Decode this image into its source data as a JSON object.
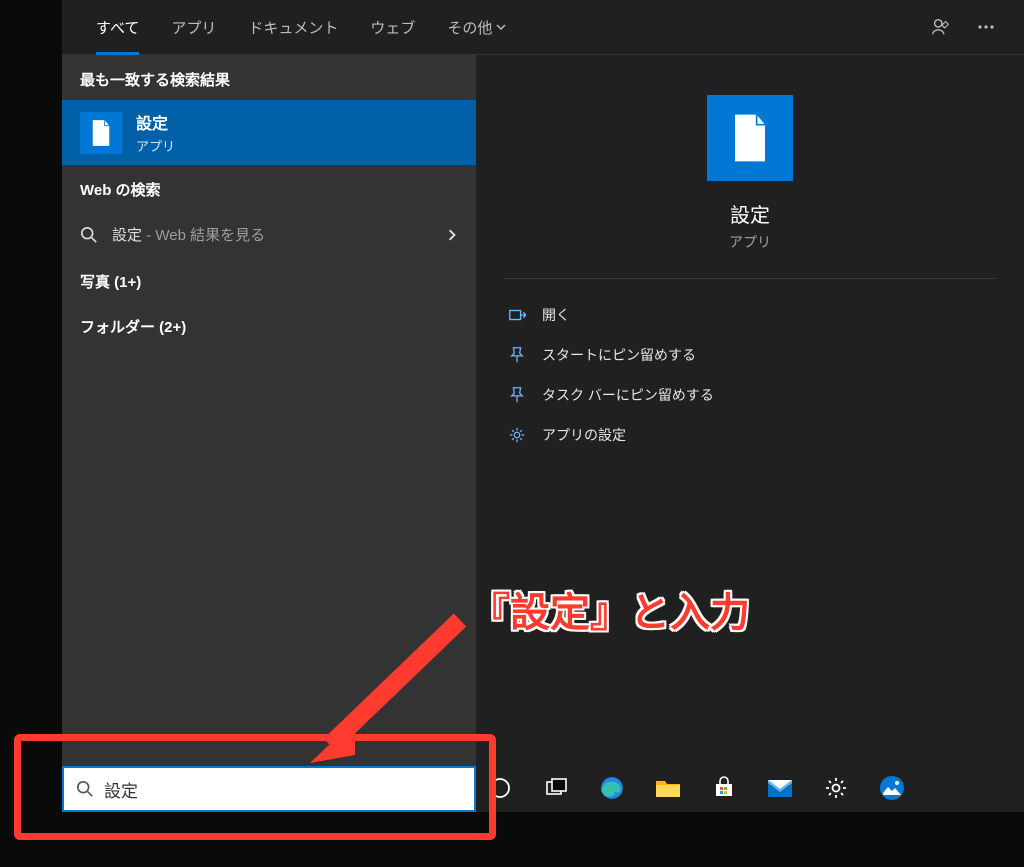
{
  "tabs": {
    "items": [
      {
        "label": "すべて",
        "active": true
      },
      {
        "label": "アプリ",
        "active": false
      },
      {
        "label": "ドキュメント",
        "active": false
      },
      {
        "label": "ウェブ",
        "active": false
      },
      {
        "label": "その他",
        "active": false,
        "dropdown": true
      }
    ]
  },
  "left": {
    "bestMatchHeader": "最も一致する検索結果",
    "bestMatch": {
      "title": "設定",
      "subtitle": "アプリ"
    },
    "webHeader": "Web の検索",
    "webSearch": {
      "query": "設定",
      "suffix": " - Web 結果を見る"
    },
    "categories": [
      {
        "label": "写真 (1+)"
      },
      {
        "label": "フォルダー (2+)"
      }
    ]
  },
  "preview": {
    "title": "設定",
    "subtitle": "アプリ",
    "actions": [
      {
        "label": "開く",
        "icon": "open"
      },
      {
        "label": "スタートにピン留めする",
        "icon": "pin"
      },
      {
        "label": "タスク バーにピン留めする",
        "icon": "pin"
      },
      {
        "label": "アプリの設定",
        "icon": "gear"
      }
    ]
  },
  "search": {
    "value": "設定"
  },
  "annotation": {
    "text": "『設定』と入力"
  }
}
